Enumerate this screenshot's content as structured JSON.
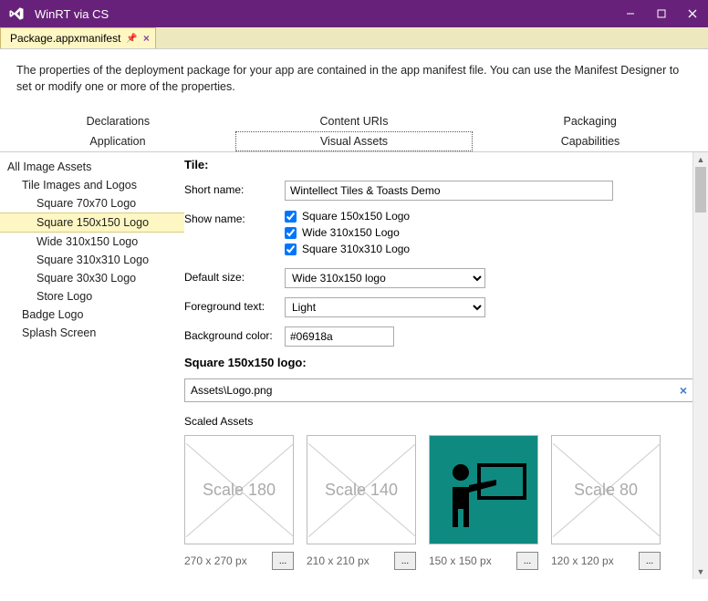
{
  "window": {
    "title": "WinRT via CS"
  },
  "tab": {
    "filename": "Package.appxmanifest"
  },
  "infobar": {
    "text": "The properties of the deployment package for your app are contained in the app manifest file. You can use the Manifest Designer to set or modify one or more of the properties."
  },
  "mainTabs": {
    "row1": [
      "Declarations",
      "Content URIs",
      "Packaging"
    ],
    "row2": [
      "Application",
      "Visual Assets",
      "Capabilities"
    ],
    "selected": "Visual Assets"
  },
  "sidebar": {
    "items": [
      {
        "label": "All Image Assets",
        "level": 0
      },
      {
        "label": "Tile Images and Logos",
        "level": 1
      },
      {
        "label": "Square 70x70 Logo",
        "level": 2
      },
      {
        "label": "Square 150x150 Logo",
        "level": 2,
        "selected": true
      },
      {
        "label": "Wide 310x150 Logo",
        "level": 2
      },
      {
        "label": "Square 310x310 Logo",
        "level": 2
      },
      {
        "label": "Square 30x30 Logo",
        "level": 2
      },
      {
        "label": "Store Logo",
        "level": 2
      },
      {
        "label": "Badge Logo",
        "level": 1
      },
      {
        "label": "Splash Screen",
        "level": 1
      }
    ]
  },
  "form": {
    "section_title": "Tile:",
    "short_name_label": "Short name:",
    "short_name_value": "Wintellect Tiles & Toasts Demo",
    "show_name_label": "Show name:",
    "show_name": [
      {
        "label": "Square 150x150 Logo",
        "checked": true
      },
      {
        "label": "Wide 310x150 Logo",
        "checked": true
      },
      {
        "label": "Square 310x310 Logo",
        "checked": true
      }
    ],
    "default_size_label": "Default size:",
    "default_size_value": "Wide 310x150 logo",
    "foreground_label": "Foreground text:",
    "foreground_value": "Light",
    "bgcolor_label": "Background color:",
    "bgcolor_value": "#06918a",
    "logo_head": "Square 150x150 logo:",
    "logo_path": "Assets\\Logo.png",
    "scaled_label": "Scaled Assets",
    "assets": [
      {
        "scale": "Scale 180",
        "dim": "270 x 270 px",
        "empty": true
      },
      {
        "scale": "Scale 140",
        "dim": "210 x 210 px",
        "empty": true
      },
      {
        "scale": "",
        "dim": "150 x 150 px",
        "empty": false
      },
      {
        "scale": "Scale 80",
        "dim": "120 x 120 px",
        "empty": true
      }
    ],
    "browse": "..."
  }
}
